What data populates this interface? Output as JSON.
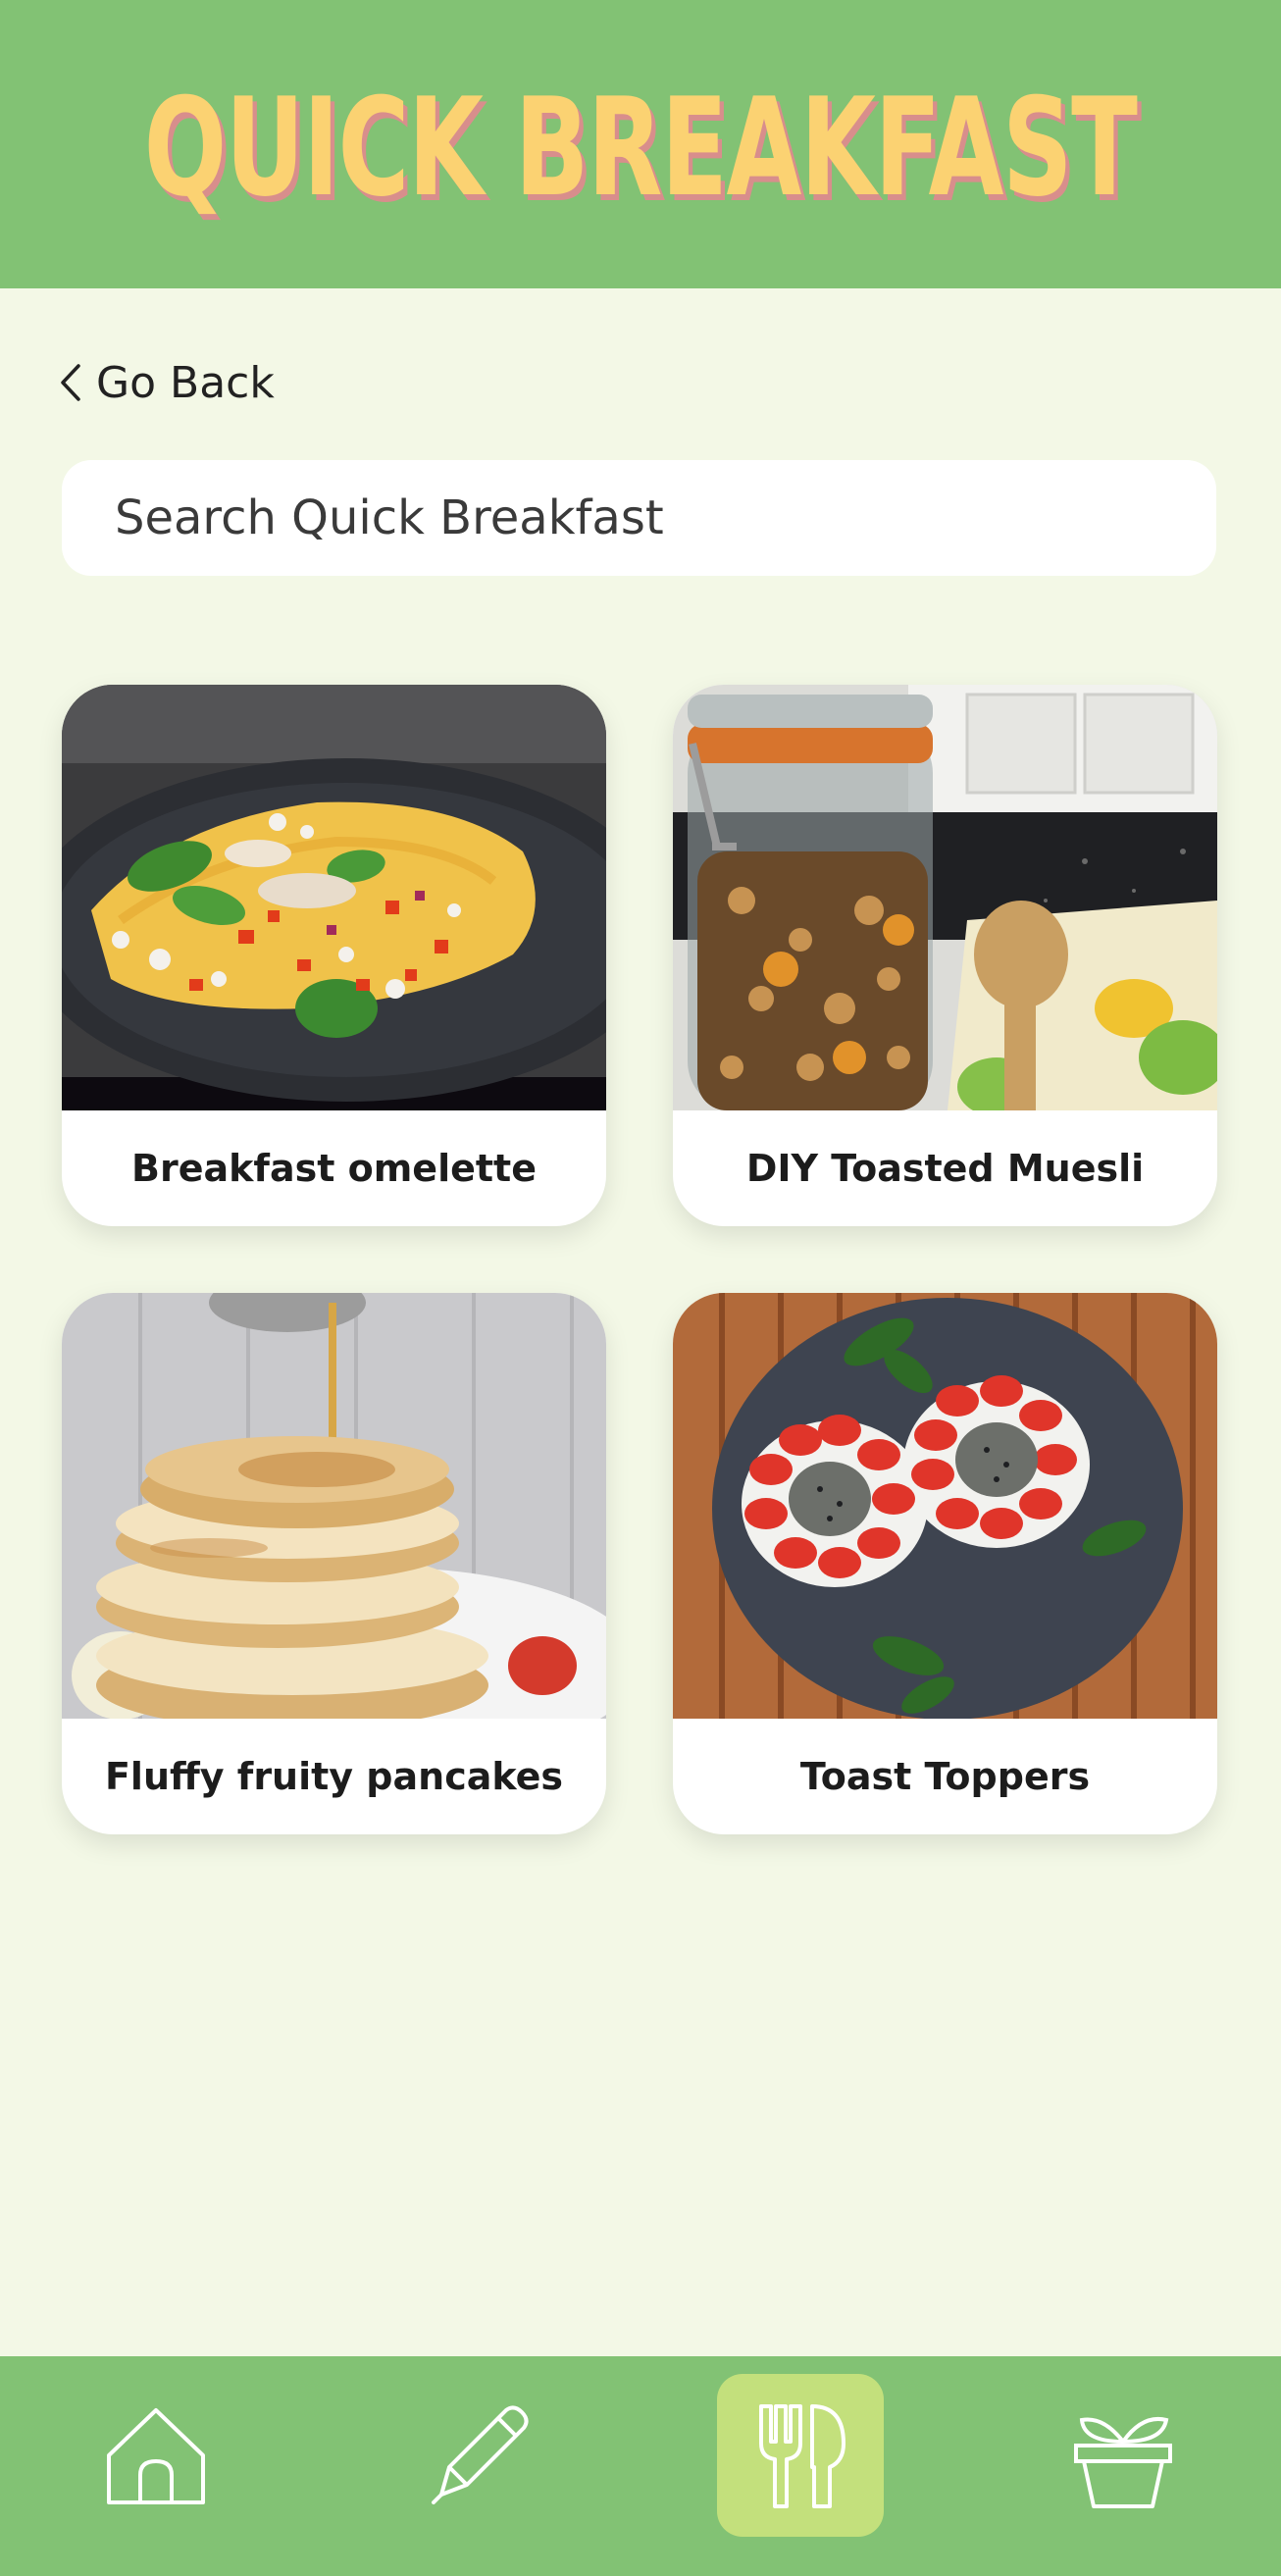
{
  "header": {
    "title": "QUICK BREAKFAST"
  },
  "nav": {
    "back_label": "Go Back"
  },
  "search": {
    "placeholder": "Search Quick Breakfast"
  },
  "recipes": [
    {
      "label": "Breakfast omelette"
    },
    {
      "label": "DIY Toasted Muesli"
    },
    {
      "label": "Fluffy fruity pancakes"
    },
    {
      "label": "Toast Toppers"
    }
  ],
  "bottom_nav": {
    "items": [
      {
        "icon": "home-icon"
      },
      {
        "icon": "pencil-icon"
      },
      {
        "icon": "fork-knife-icon",
        "active": true
      },
      {
        "icon": "plant-pot-icon"
      }
    ]
  },
  "colors": {
    "header_bg": "#82c274",
    "title": "#fbd272",
    "title_shadow": "#d88e8c",
    "page_bg": "#f3f8e6",
    "active_nav": "#c3e07c"
  }
}
